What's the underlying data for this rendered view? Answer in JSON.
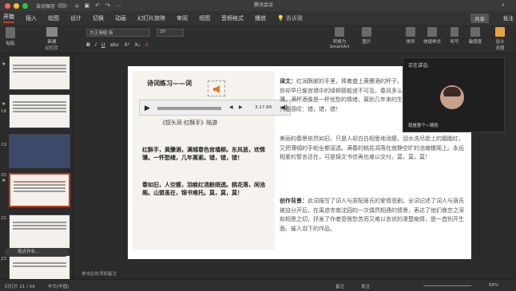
{
  "titlebar": {
    "autosave": "自动保存",
    "doc_title": "腾讯会议"
  },
  "tabs": [
    "开始",
    "插入",
    "绘图",
    "设计",
    "切换",
    "动画",
    "幻灯片放映",
    "审阅",
    "视图",
    "音频格式",
    "播放"
  ],
  "tell_me": "告诉我",
  "share": "共享",
  "comment": "批注",
  "ribbon": {
    "paste": "粘贴",
    "new_slide": "新建\n幻灯片",
    "font": "方正清楷 简",
    "size": "20",
    "smartart": "转换为\nSmartArt",
    "picture": "图片",
    "arrange": "排列",
    "quick_styles": "快速样式",
    "design_ideas": "设计\n灵感",
    "dictate": "听写",
    "sensitivity": "敏感度"
  },
  "format_buttons": [
    "B",
    "I",
    "U",
    "abc",
    "X²",
    "X₂",
    "A"
  ],
  "thumbs": {
    "numbers": [
      "17",
      "18",
      "19",
      "20",
      "21",
      "22",
      "23"
    ],
    "stars": [
      "★",
      "★",
      "★"
    ]
  },
  "status_pill": "观点作业...",
  "slide": {
    "title": "诗词练习——词",
    "subtitle": "《钗头凤·红酥手》陆游",
    "time": "3:17.89",
    "poem1": "红酥手，黄縢酒，满城春色宫墙柳。东风恶，欢情薄。一怀愁绪，几年离索。错，错，错！",
    "poem2": "春如旧，人空瘦，泪痕红浥鲛绡透。桃花落，闲池阁。山盟虽在，锦书难托。莫，莫，莫！",
    "translation_label": "译文：",
    "translation": "红润酥腻的手里，捧着盛上黄縢酒的杯子。满城荡漾着春天的景色，你却早已像宫墙中的绿柳那般遥不可及。春风多么可恶，欢情被吹得那样稀薄。满杯酒像是一杯忧愁的情绪，离别几年来的生活十分萧索。遥想当初，只能感叹：错，错，错！",
    "para2": "美丽的春景依然如旧，只是人却白白相思地消瘦。泪水洗尽脸上的胭脂红，又把薄绸的手帕全都湿透。满春的桃花凋落在寂静空旷的池塘楼阁上。永远相爱的誓言还在，可是锦文书信再也难以交付。莫，莫，莫！",
    "bg_label": "创作背景：",
    "background": "此词描写了词人与原配唐氏的爱情悲剧。全词记述了词人与唐氏被迫分开后，在禹迹寺南沈园的一次偶然相遇的情景，表达了他们眷恋之深和相思之切，抒发了作者怨恨愁苦而又难以言状的凄楚痴情，是一首别开生面、催人泪下的作品。"
  },
  "meeting": {
    "speaking": "正在讲话:",
    "name": "就是那个~晴雨"
  },
  "notes": "单击此处添加备注",
  "status": {
    "slide_count": "幻灯片 21 / 59",
    "language": "中文(中国)",
    "notes_btn": "备注",
    "comments_btn": "批注",
    "zoom": "88%"
  }
}
